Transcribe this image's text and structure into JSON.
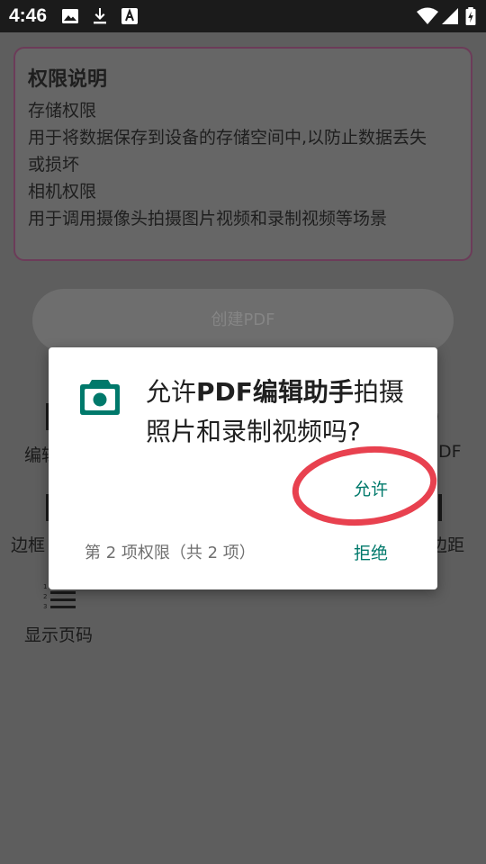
{
  "status_bar": {
    "time": "4:46",
    "icons": [
      "image-icon",
      "download-icon",
      "accessibility-a-icon",
      "wifi-icon",
      "signal-icon",
      "battery-charging-icon"
    ]
  },
  "permission_card": {
    "title": "权限说明",
    "lines": [
      "存储权限",
      "用于将数据保存到设备的存储空间中,以防止数据丢失",
      "或损坏",
      "相机权限",
      "用于调用摄像头拍摄图片视频和录制视频等场景"
    ]
  },
  "create_button": {
    "label": "创建PDF"
  },
  "background_items": {
    "edit_partial": "编辑",
    "pdf_partial": "DF",
    "border_partial": "边框",
    "margin_partial": "边距",
    "show_page_numbers": "显示页码"
  },
  "dialog": {
    "msg_prefix": "允许",
    "app_name": "PDF编辑助手",
    "msg_suffix": "拍摄照片和录制视频吗?",
    "allow_label": "允许",
    "deny_label": "拒绝",
    "counter": "第 2 项权限（共 2 项）"
  },
  "colors": {
    "accent": "#00796b",
    "annotation_red": "#e8414f",
    "card_border": "#6c3c59"
  }
}
